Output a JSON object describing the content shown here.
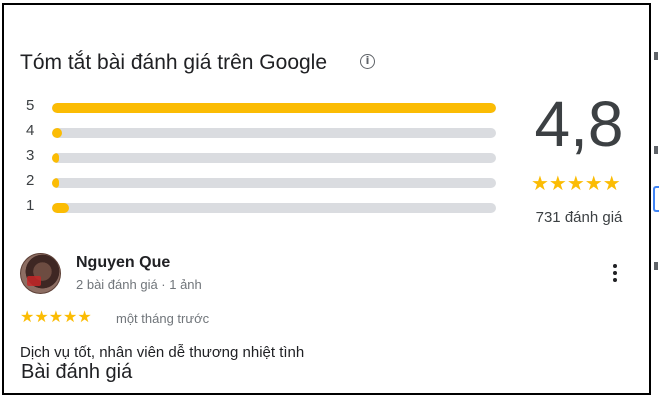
{
  "summary": {
    "title": "Tóm tắt bài đánh giá trên Google",
    "info_icon": "info-icon",
    "score": "4,8",
    "stars": "★★★★★",
    "count_label": "731 đánh giá",
    "distribution": [
      {
        "label": "5",
        "fraction": 1.0
      },
      {
        "label": "4",
        "fraction": 0.022
      },
      {
        "label": "3",
        "fraction": 0.005
      },
      {
        "label": "2",
        "fraction": 0.008
      },
      {
        "label": "1",
        "fraction": 0.038
      }
    ]
  },
  "review": {
    "author": "Nguyen Que",
    "meta": "2 bài đánh giá · 1 ảnh",
    "stars": "★★★★★",
    "time": "một tháng trước",
    "text": "Dịch vụ tốt, nhân viên dễ thương nhiệt tình",
    "menu_icon": "more-vert-icon"
  },
  "section_heading": "Bài đánh giá",
  "colors": {
    "star": "#fbbc04",
    "track": "#dadce0",
    "text": "#202124",
    "muted": "#70757a"
  }
}
